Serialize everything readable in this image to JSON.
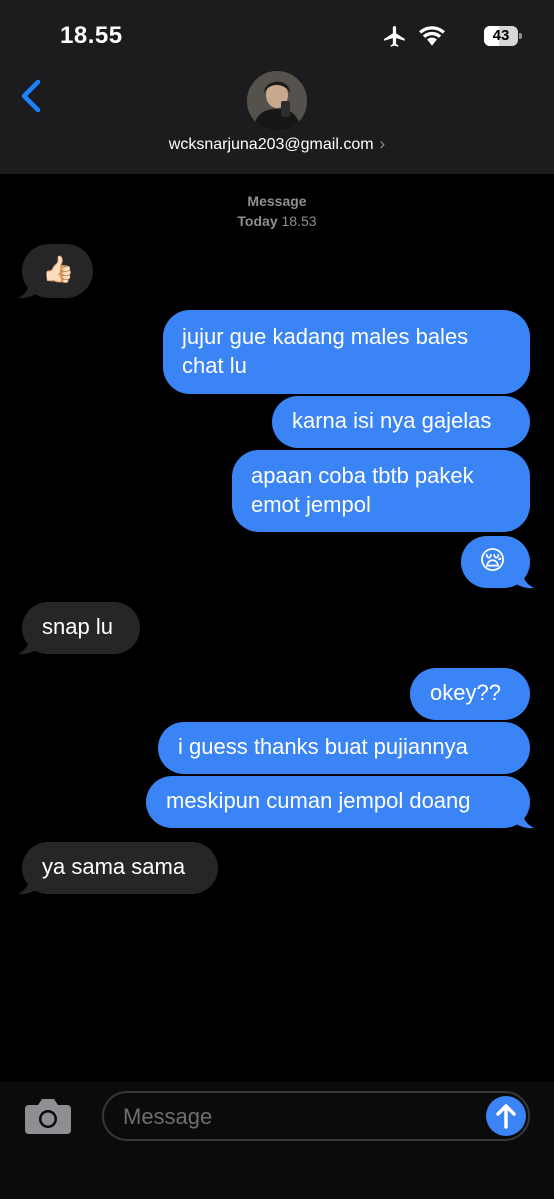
{
  "status_bar": {
    "time": "18.55",
    "battery": "43",
    "battery_level": 0.43,
    "icons": [
      "airplane-icon",
      "wifi-icon",
      "battery-icon"
    ]
  },
  "header": {
    "back_icon": "chevron-left-icon",
    "contact": "wcksnarjuna203@gmail.com",
    "contact_chevron": "›"
  },
  "thread": {
    "service": "Message",
    "day": "Today",
    "time": "18.53"
  },
  "messages": [
    {
      "dir": "in",
      "text": "👍🏻"
    },
    {
      "dir": "out",
      "lines": [
        "jujur gue kadang males bales",
        "chat lu"
      ]
    },
    {
      "dir": "out",
      "text": "karna isi nya gajelas"
    },
    {
      "dir": "out",
      "lines": [
        "apaan coba tbtb pakek",
        "emot jempol"
      ]
    },
    {
      "dir": "out",
      "text": "😪"
    },
    {
      "dir": "in",
      "text": "snap lu"
    },
    {
      "dir": "out",
      "text": "okey??"
    },
    {
      "dir": "out",
      "text": "i guess thanks buat pujiannya"
    },
    {
      "dir": "out",
      "text": "meskipun cuman jempol doang"
    },
    {
      "dir": "in",
      "text": "ya sama sama"
    }
  ],
  "composer": {
    "camera_icon": "camera-icon",
    "placeholder": "Message",
    "send_icon": "arrow-up-icon"
  },
  "colors": {
    "background": "#000000",
    "header": "#1c1c1e",
    "incoming_bubble": "#262628",
    "outgoing_bubble": "#3a84f5",
    "accent": "#1a82fb",
    "meta_text": "#8e8e93"
  }
}
